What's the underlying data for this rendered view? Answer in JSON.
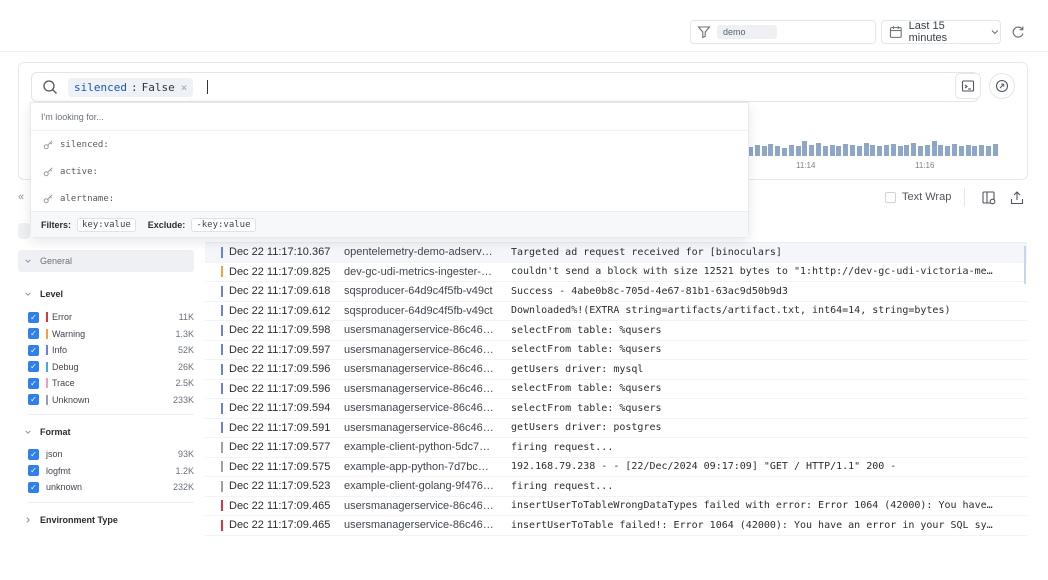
{
  "header": {
    "environment_value": "demo",
    "time_range_label": "Last 15 minutes"
  },
  "query": {
    "chip_key": "silenced",
    "chip_sep": ":",
    "chip_value": "False",
    "chip_remove": "×"
  },
  "dropdown": {
    "heading": "I'm looking for...",
    "suggestions": [
      "silenced:",
      "active:",
      "alertname:"
    ],
    "filters_label": "Filters:",
    "filters_example": "key:value",
    "exclude_label": "Exclude:",
    "exclude_example": "-key:value"
  },
  "histogram": {
    "tick_labels": [
      "11:14",
      "11:16"
    ],
    "bars": [
      0.55,
      0.7,
      0.6,
      0.75,
      0.65,
      0.5,
      0.7,
      0.65,
      0.95,
      0.7,
      0.8,
      0.65,
      0.7,
      0.6,
      0.75,
      0.7,
      0.65,
      0.8,
      0.7,
      0.6,
      0.7,
      0.75,
      0.65,
      0.7,
      0.8,
      0.6,
      0.7,
      0.95,
      0.7,
      0.65,
      0.75,
      0.6,
      0.7,
      0.65,
      0.7,
      0.6,
      0.75
    ]
  },
  "toolbar": {
    "collapse_glyph": "«",
    "text_wrap_label": "Text Wrap"
  },
  "sidebar": {
    "general_label": "General",
    "level_label": "Level",
    "levels": [
      {
        "name": "Error",
        "count": "11K",
        "color": "#d9363e"
      },
      {
        "name": "Warning",
        "count": "1.3K",
        "color": "#f2a33a"
      },
      {
        "name": "Info",
        "count": "52K",
        "color": "#6b7fe0"
      },
      {
        "name": "Debug",
        "count": "26K",
        "color": "#4aa9d6"
      },
      {
        "name": "Trace",
        "count": "2.5K",
        "color": "#e8a0c8"
      },
      {
        "name": "Unknown",
        "count": "233K",
        "color": "#9aa0a8"
      }
    ],
    "format_label": "Format",
    "formats": [
      {
        "name": "json",
        "count": "93K"
      },
      {
        "name": "logfmt",
        "count": "1.2K"
      },
      {
        "name": "unknown",
        "count": "232K"
      }
    ],
    "env_type_label": "Environment Type"
  },
  "logs": [
    {
      "ts": "Dec 22 11:17:10.367",
      "svc": "opentelemetry-demo-adservic...",
      "msg": "Targeted ad request received for [binoculars]",
      "color": "#6b7fe0"
    },
    {
      "ts": "Dec 22 11:17:09.825",
      "svc": "dev-gc-udi-metrics-ingester-5...",
      "msg": "couldn't send a block with size 12521 bytes to \"1:http://dev-gc-udi-victoria-metr…",
      "color": "#f2a33a"
    },
    {
      "ts": "Dec 22 11:17:09.618",
      "svc": "sqsproducer-64d9c4f5fb-v49ct",
      "msg": "Success - 4abe0b8c-705d-4e67-81b1-63ac9d50b9d3",
      "color": "#6b7fe0"
    },
    {
      "ts": "Dec 22 11:17:09.612",
      "svc": "sqsproducer-64d9c4f5fb-v49ct",
      "msg": "Downloaded%!(EXTRA string=artifacts/artifact.txt, int64=14, string=bytes)",
      "color": "#6b7fe0"
    },
    {
      "ts": "Dec 22 11:17:09.598",
      "svc": "usersmanagerservice-86c467...",
      "msg": "selectFrom table: %qusers",
      "color": "#6b7fe0"
    },
    {
      "ts": "Dec 22 11:17:09.597",
      "svc": "usersmanagerservice-86c467...",
      "msg": "selectFrom table: %qusers",
      "color": "#6b7fe0"
    },
    {
      "ts": "Dec 22 11:17:09.596",
      "svc": "usersmanagerservice-86c467...",
      "msg": "getUsers driver: mysql",
      "color": "#6b7fe0"
    },
    {
      "ts": "Dec 22 11:17:09.596",
      "svc": "usersmanagerservice-86c467...",
      "msg": "selectFrom table: %qusers",
      "color": "#6b7fe0"
    },
    {
      "ts": "Dec 22 11:17:09.594",
      "svc": "usersmanagerservice-86c467...",
      "msg": "selectFrom table: %qusers",
      "color": "#6b7fe0"
    },
    {
      "ts": "Dec 22 11:17:09.591",
      "svc": "usersmanagerservice-86c467...",
      "msg": "getUsers driver: postgres",
      "color": "#6b7fe0"
    },
    {
      "ts": "Dec 22 11:17:09.577",
      "svc": "example-client-python-5dc7b...",
      "msg": "firing request...",
      "color": "#9aa0a8"
    },
    {
      "ts": "Dec 22 11:17:09.575",
      "svc": "example-app-python-7d7bc75...",
      "msg": "192.168.79.238 - - [22/Dec/2024 09:17:09] \"GET / HTTP/1.1\" 200 -",
      "color": "#9aa0a8"
    },
    {
      "ts": "Dec 22 11:17:09.523",
      "svc": "example-client-golang-9f476d...",
      "msg": "firing request...",
      "color": "#9aa0a8"
    },
    {
      "ts": "Dec 22 11:17:09.465",
      "svc": "usersmanagerservice-86c467...",
      "msg": "insertUserToTableWrongDataTypes failed with error: Error 1064 (42000): You have a…",
      "color": "#d9363e"
    },
    {
      "ts": "Dec 22 11:17:09.465",
      "svc": "usersmanagerservice-86c467...",
      "msg": "insertUserToTable failed!: Error 1064 (42000): You have an error in your SQL synt…",
      "color": "#d9363e"
    }
  ]
}
